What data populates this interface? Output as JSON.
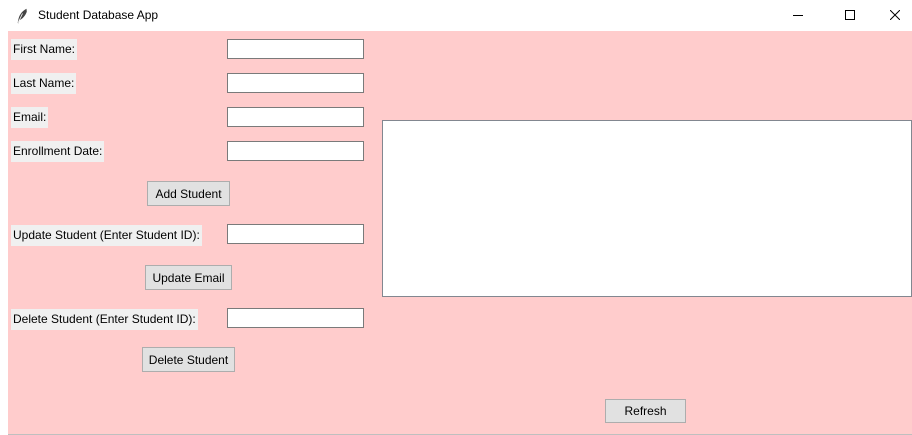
{
  "window": {
    "title": "Student Database App",
    "icon": "feather-icon",
    "controls": [
      "minimize-icon",
      "maximize-icon",
      "close-icon"
    ]
  },
  "colors": {
    "client_background": "#ffcccc",
    "label_background": "#f0f0f0",
    "button_background": "#e1e1e1"
  },
  "form": {
    "first_name_label": "First Name:",
    "first_name_value": "",
    "last_name_label": "Last Name:",
    "last_name_value": "",
    "email_label": "Email:",
    "email_value": "",
    "enrollment_date_label": "Enrollment Date:",
    "enrollment_date_value": "",
    "add_button": "Add Student",
    "update_label": "Update Student (Enter Student ID):",
    "update_value": "",
    "update_button": "Update Email",
    "delete_label": "Delete Student (Enter Student ID):",
    "delete_value": "",
    "delete_button": "Delete Student"
  },
  "list": {
    "items": []
  },
  "refresh_button": "Refresh"
}
